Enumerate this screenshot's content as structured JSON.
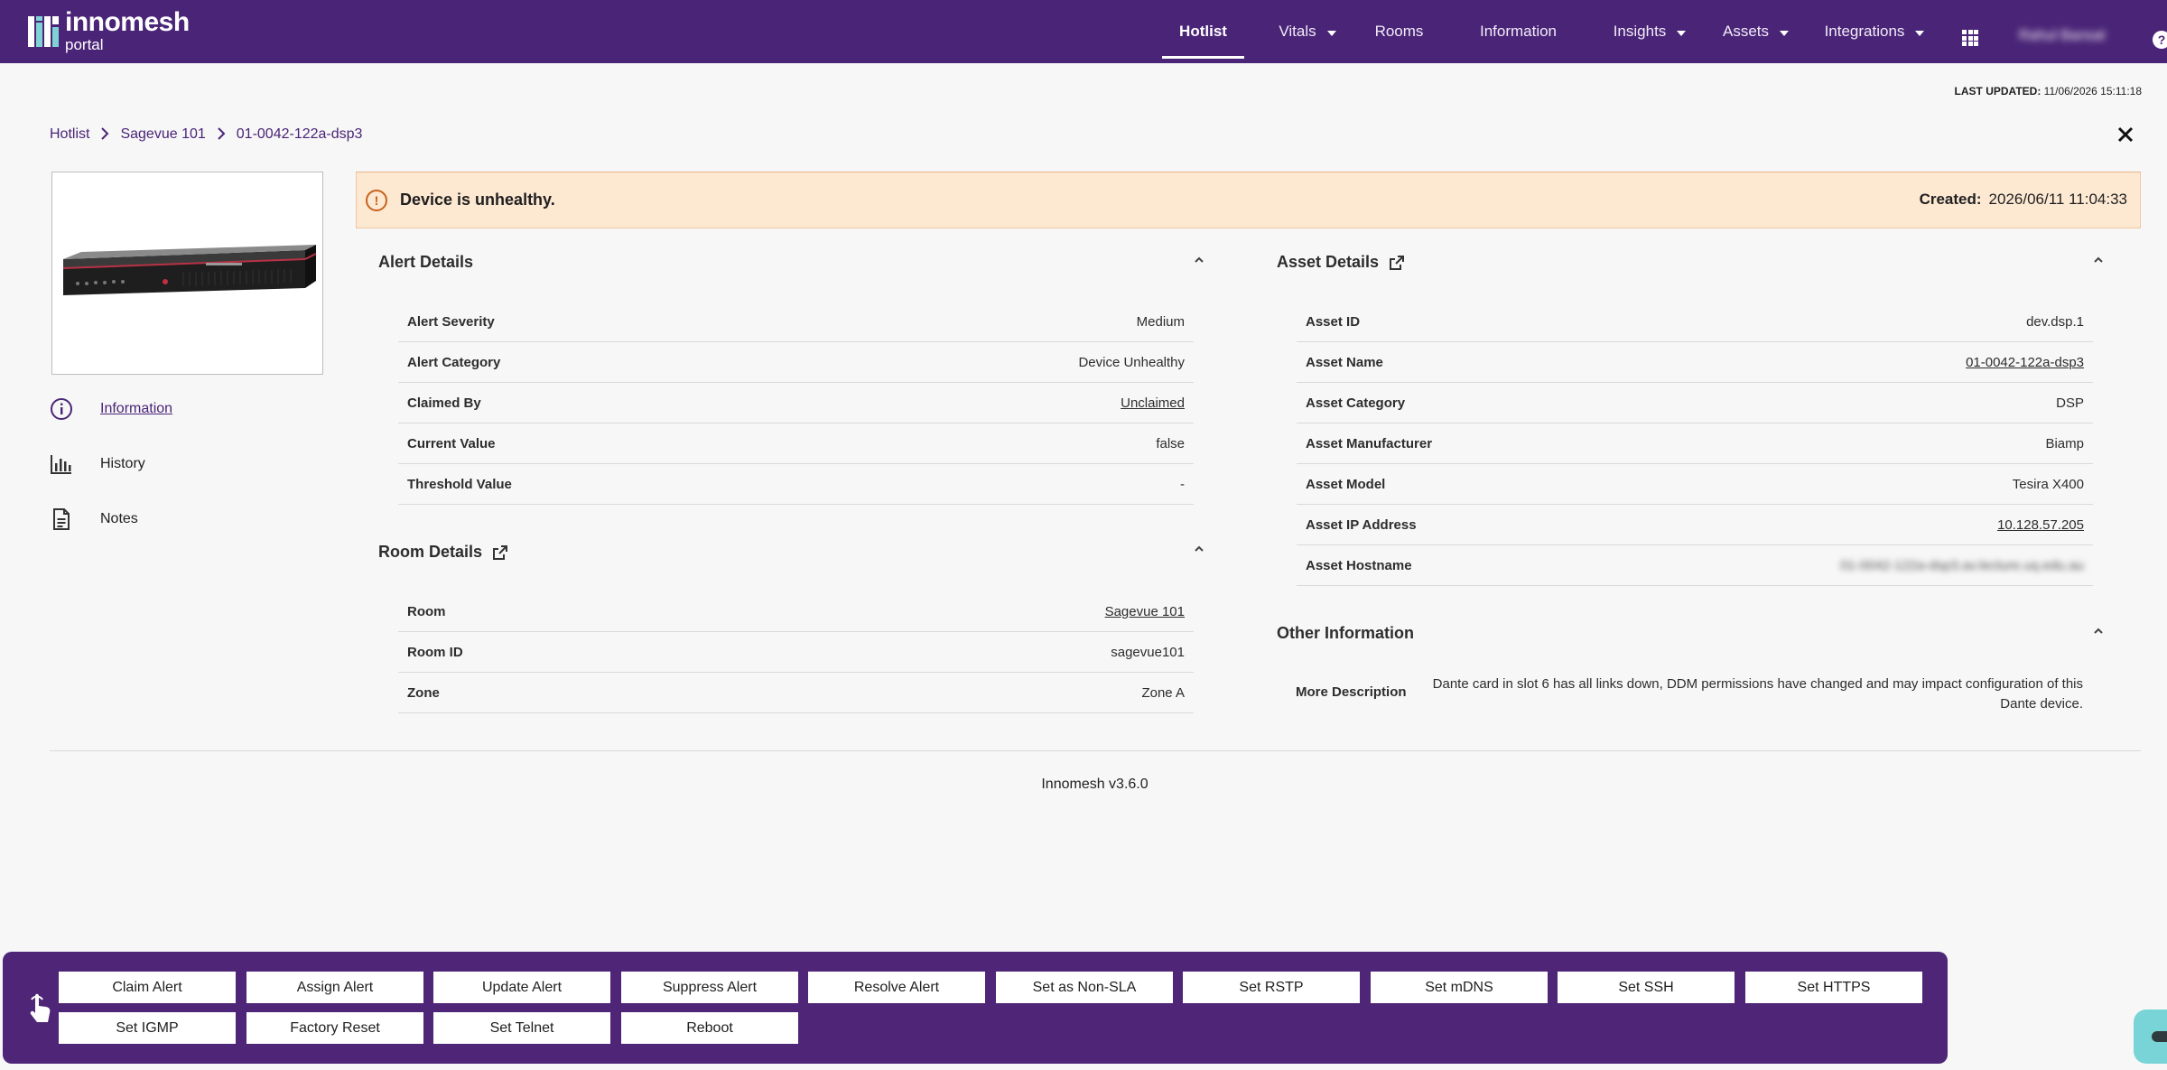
{
  "header": {
    "logo_name": "innomesh",
    "logo_sub": "portal",
    "nav": [
      {
        "label": "Hotlist",
        "active": true,
        "dropdown": false
      },
      {
        "label": "Vitals",
        "active": false,
        "dropdown": true
      },
      {
        "label": "Rooms",
        "active": false,
        "dropdown": false
      },
      {
        "label": "Information",
        "active": false,
        "dropdown": false
      },
      {
        "label": "Insights",
        "active": false,
        "dropdown": true
      },
      {
        "label": "Assets",
        "active": false,
        "dropdown": true
      },
      {
        "label": "Integrations",
        "active": false,
        "dropdown": true
      }
    ],
    "user_name": "Rahul Bansal",
    "apps_icon": "grid-icon",
    "help_icon": "help-icon",
    "brand_color": "#4a2477"
  },
  "last_updated": {
    "label": "LAST UPDATED:",
    "value": "11/06/2026 15:11:18"
  },
  "breadcrumb": [
    "Hotlist",
    "Sagevue 101",
    "01-0042-122a-dsp3"
  ],
  "side_nav": [
    {
      "label": "Information",
      "icon": "info-icon",
      "active": true
    },
    {
      "label": "History",
      "icon": "bar-chart-icon",
      "active": false
    },
    {
      "label": "Notes",
      "icon": "document-icon",
      "active": false
    }
  ],
  "banner": {
    "message": "Device is unhealthy.",
    "created_label": "Created:",
    "created_value": "2026/06/11 11:04:33",
    "color": "#fde8d2"
  },
  "alert_details": {
    "title": "Alert Details",
    "rows": [
      {
        "key": "Alert Severity",
        "value": "Medium"
      },
      {
        "key": "Alert Category",
        "value": "Device Unhealthy"
      },
      {
        "key": "Claimed By",
        "value": "Unclaimed"
      },
      {
        "key": "Current Value",
        "value": "false"
      },
      {
        "key": "Threshold Value",
        "value": "-"
      }
    ]
  },
  "room_details": {
    "title": "Room Details",
    "rows": [
      {
        "key": "Room",
        "value": "Sagevue 101"
      },
      {
        "key": "Room ID",
        "value": "sagevue101"
      },
      {
        "key": "Zone",
        "value": "Zone A"
      }
    ]
  },
  "asset_details": {
    "title": "Asset Details",
    "rows": [
      {
        "key": "Asset ID",
        "value": "dev.dsp.1"
      },
      {
        "key": "Asset Name",
        "value": "01-0042-122a-dsp3"
      },
      {
        "key": "Asset Category",
        "value": "DSP"
      },
      {
        "key": "Asset Manufacturer",
        "value": "Biamp"
      },
      {
        "key": "Asset Model",
        "value": "Tesira X400"
      },
      {
        "key": "Asset IP Address",
        "value": "10.128.57.205"
      },
      {
        "key": "Asset Hostname",
        "value": "01-0042-122a-dsp3.av.lecture.uq.edu.au"
      }
    ]
  },
  "other_information": {
    "title": "Other Information",
    "key": "More Description",
    "value": "Dante card in slot 6 has all links down, DDM permissions have changed and may impact configuration of this Dante device."
  },
  "footer": {
    "version": "Innomesh v3.6.0"
  },
  "actions": [
    "Claim Alert",
    "Assign Alert",
    "Update Alert",
    "Suppress Alert",
    "Resolve Alert",
    "Set as Non-SLA",
    "Set RSTP",
    "Set mDNS",
    "Set SSH",
    "Set HTTPS",
    "Set IGMP",
    "Factory Reset",
    "Set Telnet",
    "Reboot"
  ]
}
